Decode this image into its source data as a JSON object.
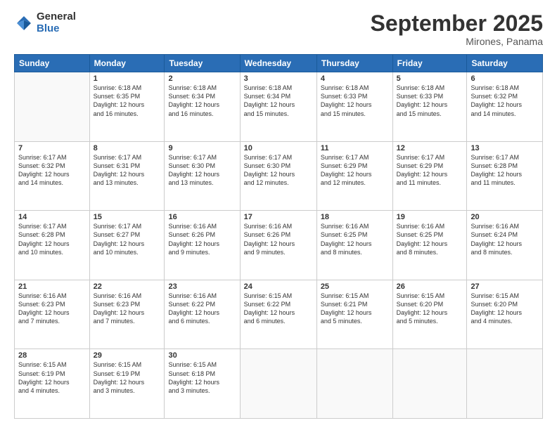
{
  "header": {
    "logo_line1": "General",
    "logo_line2": "Blue",
    "month_title": "September 2025",
    "location": "Mirones, Panama"
  },
  "weekdays": [
    "Sunday",
    "Monday",
    "Tuesday",
    "Wednesday",
    "Thursday",
    "Friday",
    "Saturday"
  ],
  "weeks": [
    [
      {
        "num": "",
        "info": ""
      },
      {
        "num": "1",
        "info": "Sunrise: 6:18 AM\nSunset: 6:35 PM\nDaylight: 12 hours\nand 16 minutes."
      },
      {
        "num": "2",
        "info": "Sunrise: 6:18 AM\nSunset: 6:34 PM\nDaylight: 12 hours\nand 16 minutes."
      },
      {
        "num": "3",
        "info": "Sunrise: 6:18 AM\nSunset: 6:34 PM\nDaylight: 12 hours\nand 15 minutes."
      },
      {
        "num": "4",
        "info": "Sunrise: 6:18 AM\nSunset: 6:33 PM\nDaylight: 12 hours\nand 15 minutes."
      },
      {
        "num": "5",
        "info": "Sunrise: 6:18 AM\nSunset: 6:33 PM\nDaylight: 12 hours\nand 15 minutes."
      },
      {
        "num": "6",
        "info": "Sunrise: 6:18 AM\nSunset: 6:32 PM\nDaylight: 12 hours\nand 14 minutes."
      }
    ],
    [
      {
        "num": "7",
        "info": "Sunrise: 6:17 AM\nSunset: 6:32 PM\nDaylight: 12 hours\nand 14 minutes."
      },
      {
        "num": "8",
        "info": "Sunrise: 6:17 AM\nSunset: 6:31 PM\nDaylight: 12 hours\nand 13 minutes."
      },
      {
        "num": "9",
        "info": "Sunrise: 6:17 AM\nSunset: 6:30 PM\nDaylight: 12 hours\nand 13 minutes."
      },
      {
        "num": "10",
        "info": "Sunrise: 6:17 AM\nSunset: 6:30 PM\nDaylight: 12 hours\nand 12 minutes."
      },
      {
        "num": "11",
        "info": "Sunrise: 6:17 AM\nSunset: 6:29 PM\nDaylight: 12 hours\nand 12 minutes."
      },
      {
        "num": "12",
        "info": "Sunrise: 6:17 AM\nSunset: 6:29 PM\nDaylight: 12 hours\nand 11 minutes."
      },
      {
        "num": "13",
        "info": "Sunrise: 6:17 AM\nSunset: 6:28 PM\nDaylight: 12 hours\nand 11 minutes."
      }
    ],
    [
      {
        "num": "14",
        "info": "Sunrise: 6:17 AM\nSunset: 6:28 PM\nDaylight: 12 hours\nand 10 minutes."
      },
      {
        "num": "15",
        "info": "Sunrise: 6:17 AM\nSunset: 6:27 PM\nDaylight: 12 hours\nand 10 minutes."
      },
      {
        "num": "16",
        "info": "Sunrise: 6:16 AM\nSunset: 6:26 PM\nDaylight: 12 hours\nand 9 minutes."
      },
      {
        "num": "17",
        "info": "Sunrise: 6:16 AM\nSunset: 6:26 PM\nDaylight: 12 hours\nand 9 minutes."
      },
      {
        "num": "18",
        "info": "Sunrise: 6:16 AM\nSunset: 6:25 PM\nDaylight: 12 hours\nand 8 minutes."
      },
      {
        "num": "19",
        "info": "Sunrise: 6:16 AM\nSunset: 6:25 PM\nDaylight: 12 hours\nand 8 minutes."
      },
      {
        "num": "20",
        "info": "Sunrise: 6:16 AM\nSunset: 6:24 PM\nDaylight: 12 hours\nand 8 minutes."
      }
    ],
    [
      {
        "num": "21",
        "info": "Sunrise: 6:16 AM\nSunset: 6:23 PM\nDaylight: 12 hours\nand 7 minutes."
      },
      {
        "num": "22",
        "info": "Sunrise: 6:16 AM\nSunset: 6:23 PM\nDaylight: 12 hours\nand 7 minutes."
      },
      {
        "num": "23",
        "info": "Sunrise: 6:16 AM\nSunset: 6:22 PM\nDaylight: 12 hours\nand 6 minutes."
      },
      {
        "num": "24",
        "info": "Sunrise: 6:15 AM\nSunset: 6:22 PM\nDaylight: 12 hours\nand 6 minutes."
      },
      {
        "num": "25",
        "info": "Sunrise: 6:15 AM\nSunset: 6:21 PM\nDaylight: 12 hours\nand 5 minutes."
      },
      {
        "num": "26",
        "info": "Sunrise: 6:15 AM\nSunset: 6:20 PM\nDaylight: 12 hours\nand 5 minutes."
      },
      {
        "num": "27",
        "info": "Sunrise: 6:15 AM\nSunset: 6:20 PM\nDaylight: 12 hours\nand 4 minutes."
      }
    ],
    [
      {
        "num": "28",
        "info": "Sunrise: 6:15 AM\nSunset: 6:19 PM\nDaylight: 12 hours\nand 4 minutes."
      },
      {
        "num": "29",
        "info": "Sunrise: 6:15 AM\nSunset: 6:19 PM\nDaylight: 12 hours\nand 3 minutes."
      },
      {
        "num": "30",
        "info": "Sunrise: 6:15 AM\nSunset: 6:18 PM\nDaylight: 12 hours\nand 3 minutes."
      },
      {
        "num": "",
        "info": ""
      },
      {
        "num": "",
        "info": ""
      },
      {
        "num": "",
        "info": ""
      },
      {
        "num": "",
        "info": ""
      }
    ]
  ]
}
